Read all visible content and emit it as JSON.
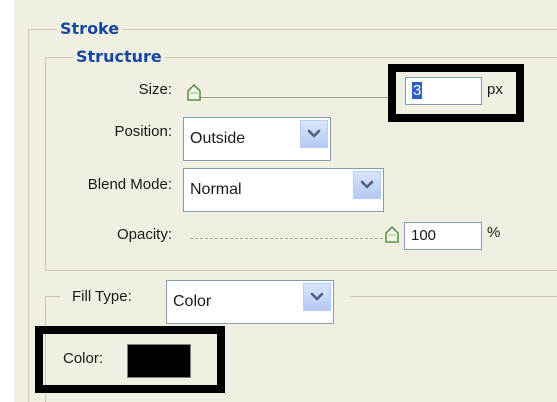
{
  "groups": {
    "stroke_title": "Stroke",
    "structure_title": "Structure"
  },
  "fields": {
    "size_label": "Size:",
    "size_value": "3",
    "size_unit": "px",
    "size_slider_level": 0.0,
    "position_label": "Position:",
    "position_value": "Outside",
    "blend_label": "Blend Mode:",
    "blend_value": "Normal",
    "opacity_label": "Opacity:",
    "opacity_value": "100",
    "opacity_unit": "%",
    "opacity_slider_level": 1.0,
    "filltype_label": "Fill Type:",
    "filltype_value": "Color",
    "color_label": "Color:",
    "color_swatch": "#000000"
  },
  "colors": {
    "title": "#15489f",
    "highlight": "#000000",
    "dropdown_accent": "#6d8fd6"
  },
  "icons": {
    "slider_thumb": "slider-thumb-icon",
    "dropdown": "chevron-down-icon"
  }
}
